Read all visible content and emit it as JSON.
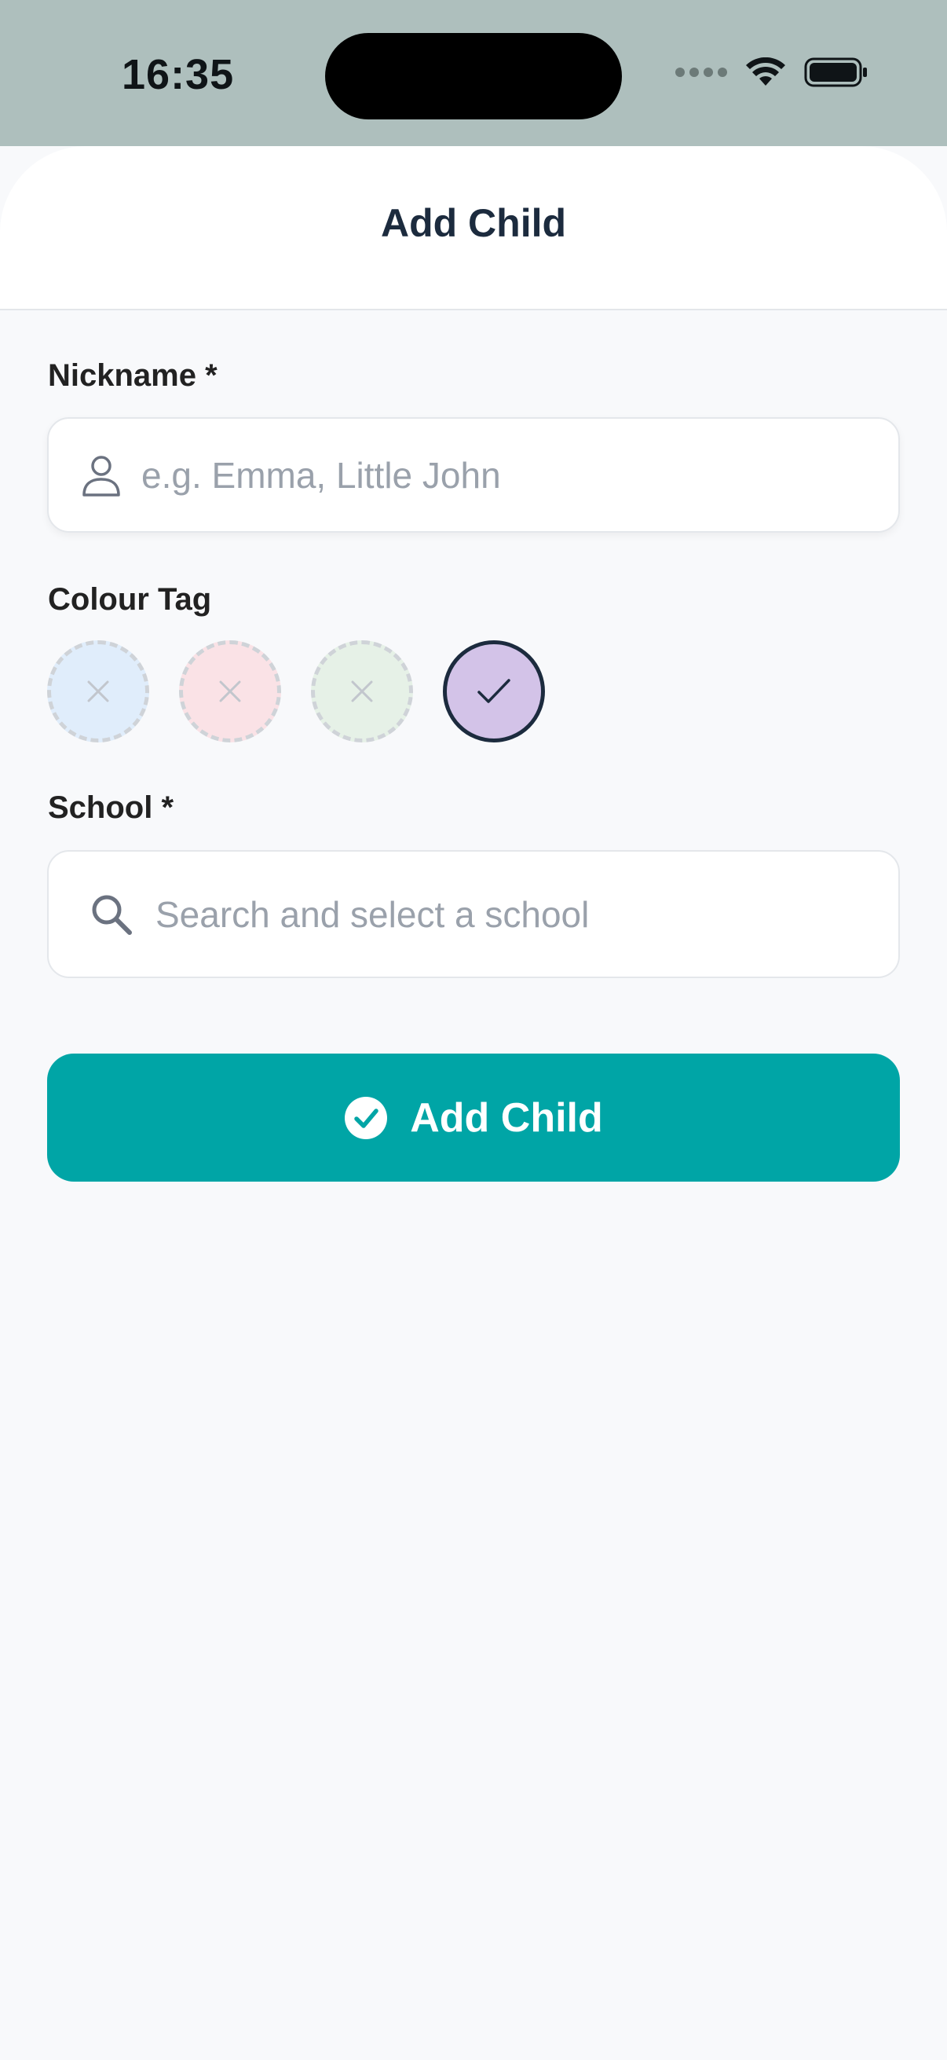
{
  "status_bar": {
    "time": "16:35"
  },
  "sheet": {
    "title": "Add Child"
  },
  "form": {
    "nickname": {
      "label": "Nickname *",
      "placeholder": "e.g. Emma, Little John",
      "value": ""
    },
    "colour_tag": {
      "label": "Colour Tag",
      "options": [
        {
          "color": "#dcecfb",
          "state": "unavailable",
          "icon": "x-icon"
        },
        {
          "color": "#fbdfe3",
          "state": "unavailable",
          "icon": "x-icon"
        },
        {
          "color": "#e3f0e4",
          "state": "unavailable",
          "icon": "x-icon"
        },
        {
          "color": "#d3c3e8",
          "state": "selected",
          "icon": "checkmark-icon"
        }
      ]
    },
    "school": {
      "label": "School *",
      "placeholder": "Search and select a school",
      "value": ""
    },
    "submit": {
      "label": "Add Child",
      "icon": "check-circle-icon"
    }
  },
  "colors": {
    "accent": "#00a5a6",
    "title": "#1c2b3e",
    "status_bar_bg": "#aebfbd"
  }
}
